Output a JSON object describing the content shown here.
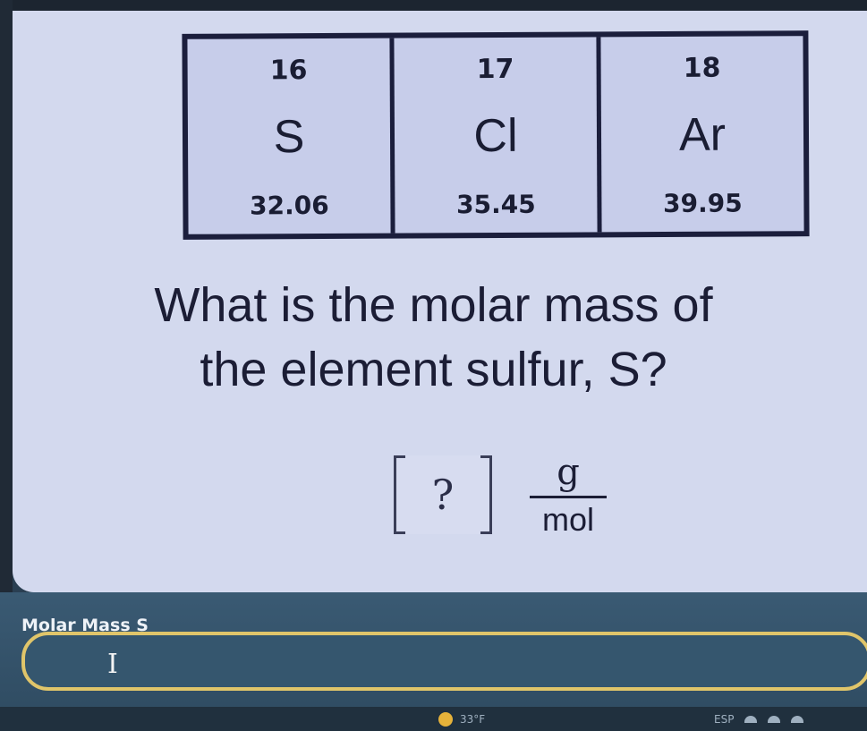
{
  "elements": [
    {
      "number": "16",
      "symbol": "S",
      "mass": "32.06"
    },
    {
      "number": "17",
      "symbol": "Cl",
      "mass": "35.45"
    },
    {
      "number": "18",
      "symbol": "Ar",
      "mass": "39.95"
    }
  ],
  "question": {
    "line1": "What is the molar mass of",
    "line2": "the element sulfur, S?"
  },
  "answer": {
    "placeholder_mark": "?",
    "unit_numerator": "g",
    "unit_denominator": "mol"
  },
  "input": {
    "label": "Molar Mass S",
    "value": ""
  },
  "taskbar": {
    "weather_text": "33°F",
    "lang_text": "ESP"
  },
  "icons": {
    "cursor": "text-cursor-icon",
    "weather": "weather-icon"
  },
  "colors": {
    "card_bg": "#d3d9ee",
    "table_border": "#1b1e3c",
    "input_border": "#e0c56a",
    "panel_bg": "#3a5a73"
  }
}
